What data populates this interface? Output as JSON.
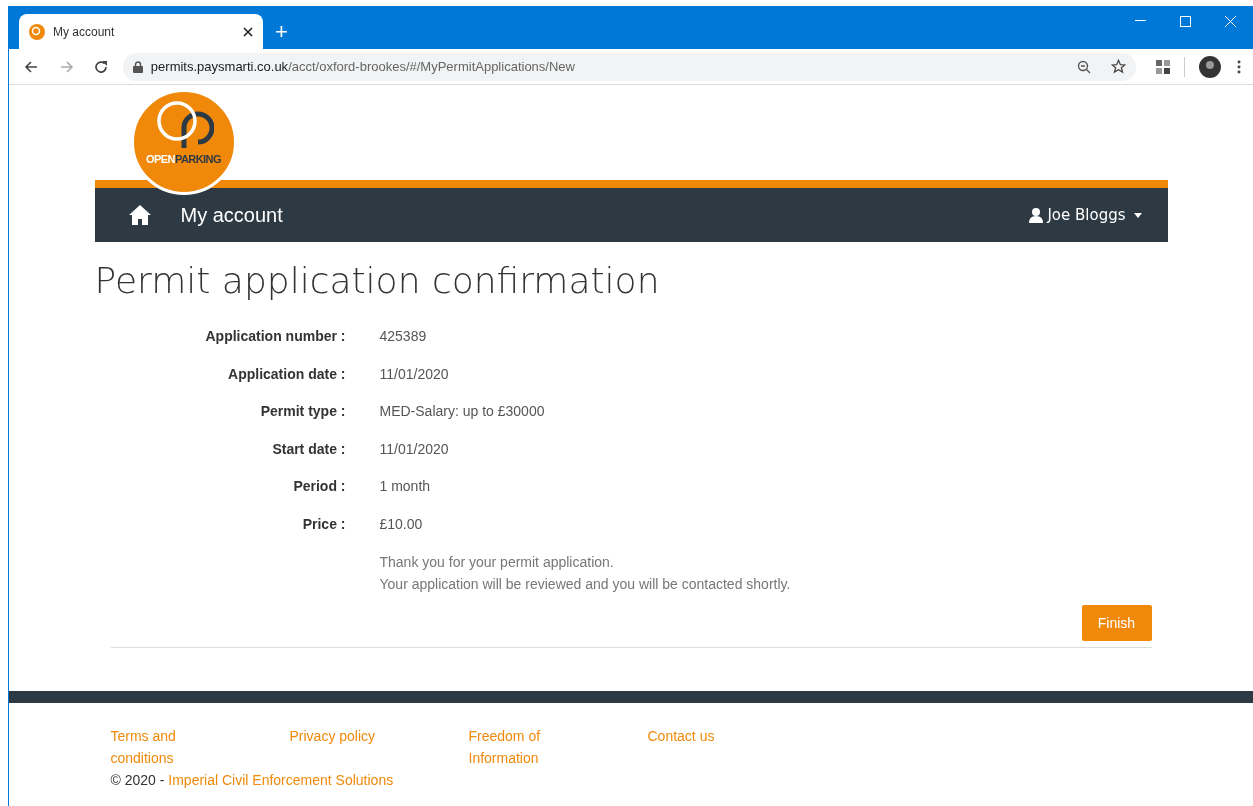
{
  "browser": {
    "tab_title": "My account",
    "new_tab": "+",
    "url_host": "permits.paysmarti.co.uk",
    "url_path": "/acct/oxford-brookes/#/MyPermitApplications/New"
  },
  "logo": {
    "word_1": "OPEN",
    "word_2": "PARKING"
  },
  "navbar": {
    "title": "My account",
    "user": "Joe Bloggs"
  },
  "page_title": "Permit application confirmation",
  "details": [
    {
      "label": "Application number :",
      "value": "425389"
    },
    {
      "label": "Application date :",
      "value": "11/01/2020"
    },
    {
      "label": "Permit type :",
      "value": "MED-Salary: up to £30000"
    },
    {
      "label": "Start date :",
      "value": "11/01/2020"
    },
    {
      "label": "Period :",
      "value": "1 month"
    },
    {
      "label": "Price :",
      "value": "£10.00"
    }
  ],
  "message": [
    "Thank you for your permit application.",
    "Your application will be reviewed and you will be contacted shortly."
  ],
  "finish_button": "Finish",
  "footer": {
    "links": [
      "Terms and conditions",
      "Privacy policy",
      "Freedom of Information",
      "Contact us"
    ],
    "copyright": "© 2020 - ",
    "company": "Imperial Civil Enforcement Solutions"
  }
}
